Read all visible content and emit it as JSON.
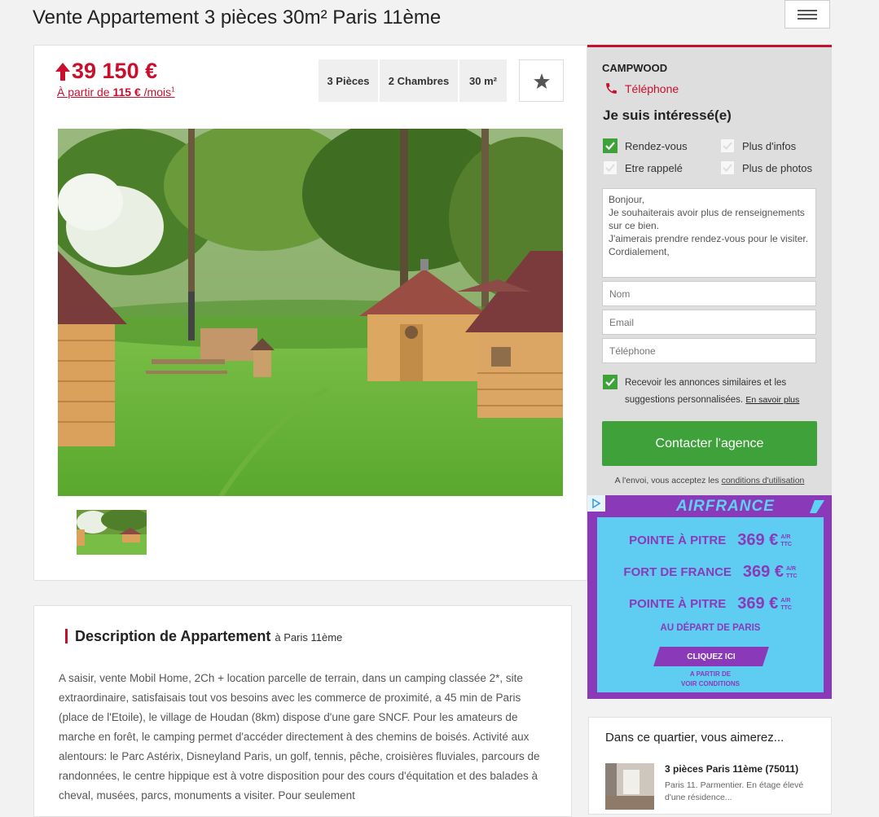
{
  "page": {
    "title": "Vente Appartement 3 pièces 30m² Paris 11ème"
  },
  "listing": {
    "price": "39 150 €",
    "monthly_prefix": "À partir de",
    "monthly_amount": "115 €",
    "monthly_suffix": "/mois",
    "monthly_footnote": "1",
    "features": [
      "3 Pièces",
      "2 Chambres",
      "30 m²"
    ]
  },
  "contact": {
    "agency": "CAMPWOOD",
    "phone_label": "Téléphone",
    "interest_title": "Je suis intéressé(e)",
    "options": [
      {
        "label": "Rendez-vous",
        "checked": true
      },
      {
        "label": "Plus d'infos",
        "checked": false
      },
      {
        "label": "Etre rappelé",
        "checked": false
      },
      {
        "label": "Plus de photos",
        "checked": false
      }
    ],
    "message": "Bonjour,\nJe souhaiterais avoir plus de renseignements sur ce bien.\nJ'aimerais prendre rendez-vous pour le visiter.\nCordialement,",
    "name_placeholder": "Nom",
    "email_placeholder": "Email",
    "phone_placeholder": "Téléphone",
    "optin_text": "Recevoir les annonces similaires et les suggestions personnalisées.",
    "optin_link": "En savoir plus",
    "optin_checked": true,
    "submit_label": "Contacter l'agence",
    "terms_prefix": "A l'envoi, vous acceptez les",
    "terms_link": "conditions d'utilisation"
  },
  "ad": {
    "brand": "AIRFRANCE",
    "offers": [
      {
        "city": "POINTE À PITRE",
        "price": "369 €",
        "note_top": "A/R",
        "note_bottom": "TTC"
      },
      {
        "city": "FORT DE FRANCE",
        "price": "369 €",
        "note_top": "A/R",
        "note_bottom": "TTC"
      },
      {
        "city": "POINTE À PITRE",
        "price": "369 €",
        "note_top": "A/R",
        "note_bottom": "TTC"
      }
    ],
    "departure": "AU DÉPART DE PARIS",
    "cta": "CLIQUEZ ICI",
    "conditions_line1": "A PARTIR DE",
    "conditions_line2": "VOIR CONDITIONS"
  },
  "description": {
    "title": "Description de Appartement",
    "subtitle": "à Paris 11ème",
    "body": "A saisir, vente Mobil Home, 2Ch + location parcelle de terrain, dans un camping classée 2*, site extraordinaire, satisfaisais tout vos besoins avec les commerce de proximité, a 45 min de Paris (place de l'Etoile), le village de Houdan (8km) dispose d'une gare SNCF. Pour les amateurs de marche en forêt, le camping permet d'accéder directement à des chemins de boisés. Activité aux alentours: le Parc Astérix, Disneyland Paris, un golf, tennis, pêche, croisières fluviales, parcours de randonnées, le centre hippique est à votre disposition pour des cours d'équitation et des balades à cheval, musées, parcs, monuments a visiter. Pour seulement"
  },
  "neighborhood": {
    "title": "Dans ce quartier, vous aimerez...",
    "item_title": "3 pièces Paris 11ème (75011)",
    "item_desc": "Paris 11. Parmentier. En étage élevé d'une résidence..."
  },
  "colors": {
    "accent": "#c8102e",
    "green": "#3ea13a",
    "ad_purple": "#8a3ab9",
    "ad_blue": "#5fcdf2"
  }
}
